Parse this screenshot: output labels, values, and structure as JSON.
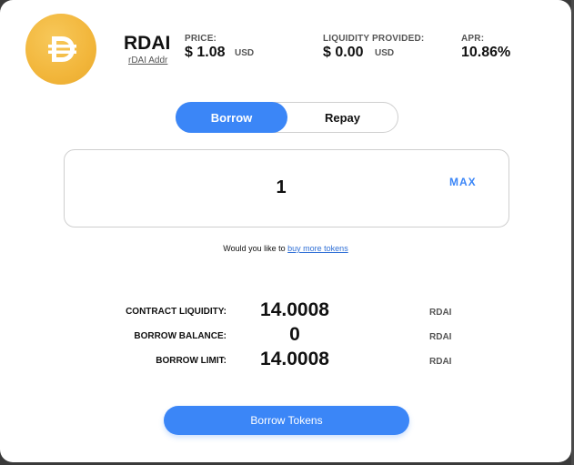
{
  "header": {
    "token_name": "RDAI",
    "token_addr_link": "rDAI Addr",
    "price_label": "PRICE:",
    "price_value": "$ 1.08",
    "price_unit": "USD",
    "liquidity_label": "LIQUIDITY PROVIDED:",
    "liquidity_value": "$ 0.00",
    "liquidity_unit": "USD",
    "apr_label": "APR:",
    "apr_value": "10.86%"
  },
  "toggle": {
    "borrow_label": "Borrow",
    "repay_label": "Repay",
    "active": "Borrow"
  },
  "amount": {
    "value": "1",
    "max_label": "MAX"
  },
  "buy_prompt": {
    "text": "Would you like to ",
    "link": "buy more tokens"
  },
  "stats": {
    "contract_liquidity_label": "CONTRACT LIQUIDITY:",
    "contract_liquidity_value": "14.0008",
    "contract_liquidity_unit": "RDAI",
    "borrow_balance_label": "BORROW BALANCE:",
    "borrow_balance_value": "0",
    "borrow_balance_unit": "RDAI",
    "borrow_limit_label": "BORROW LIMIT:",
    "borrow_limit_value": "14.0008",
    "borrow_limit_unit": "RDAI"
  },
  "action": {
    "button_label": "Borrow Tokens"
  },
  "colors": {
    "accent": "#3b86f7",
    "token_logo": "#f2b63b"
  },
  "icons": {
    "token_logo": "dai-logo-icon"
  }
}
